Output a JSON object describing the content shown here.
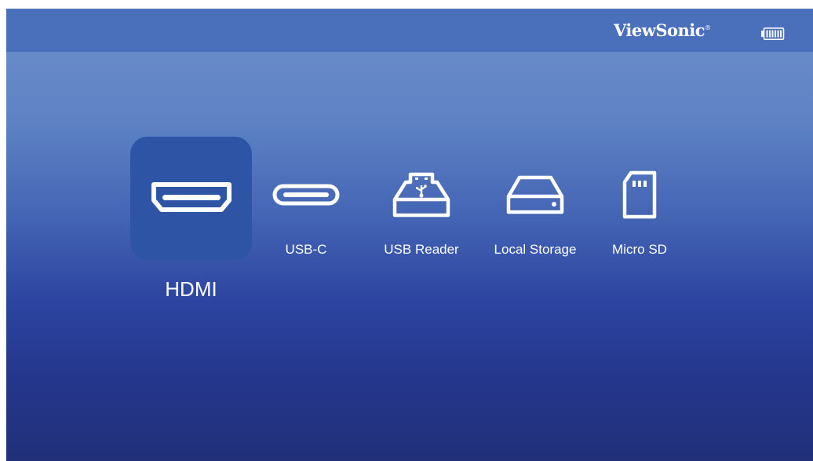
{
  "header": {
    "brand": "ViewSonic",
    "brand_mark": "®",
    "battery_icon": "battery-full-icon"
  },
  "sources": [
    {
      "id": "hdmi",
      "label": "HDMI",
      "icon": "hdmi-icon",
      "selected": true
    },
    {
      "id": "usbc",
      "label": "USB-C",
      "icon": "usb-c-icon",
      "selected": false
    },
    {
      "id": "usbreader",
      "label": "USB Reader",
      "icon": "usb-drive-icon",
      "selected": false
    },
    {
      "id": "local",
      "label": "Local Storage",
      "icon": "hard-drive-icon",
      "selected": false
    },
    {
      "id": "microsd",
      "label": "Micro SD",
      "icon": "sd-card-icon",
      "selected": false
    }
  ],
  "colors": {
    "topbar": "#4a6fbb",
    "selected_tile": "#2e54a6",
    "text": "#ffffff"
  }
}
